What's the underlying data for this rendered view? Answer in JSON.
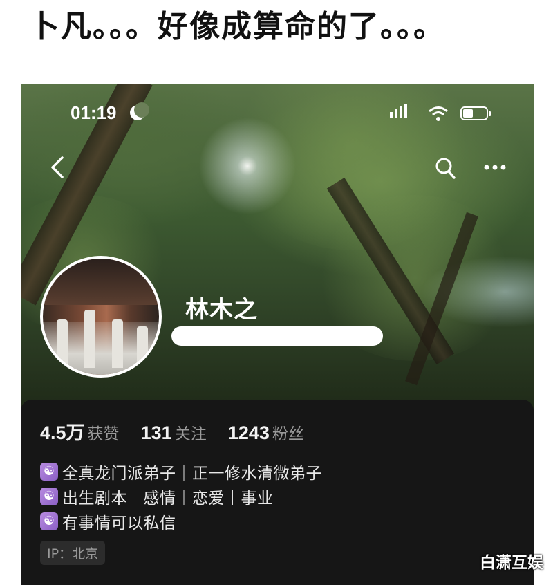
{
  "caption": "卜凡。。。好像成算命的了。。。",
  "status_bar": {
    "time": "01:19"
  },
  "profile": {
    "nickname": "林木之",
    "stats": [
      {
        "value": "4.5万",
        "label": "获赞"
      },
      {
        "value": "131",
        "label": "关注"
      },
      {
        "value": "1243",
        "label": "粉丝"
      }
    ],
    "bio": [
      "全真龙门派弟子｜正一修水清微弟子",
      "出生剧本｜感情｜恋爱｜事业",
      "有事情可以私信"
    ],
    "bio_icon": "☯",
    "ip": "IP：北京"
  },
  "icons": {
    "back": "back-arrow-icon",
    "search": "search-icon",
    "more": "more-icon",
    "bio": "yin-yang-icon"
  },
  "colors": {
    "card_bg": "#161616",
    "bio_icon_bg": "#9a6ad4",
    "muted_text": "#9a9a9a"
  },
  "watermark": "白潇互娱"
}
